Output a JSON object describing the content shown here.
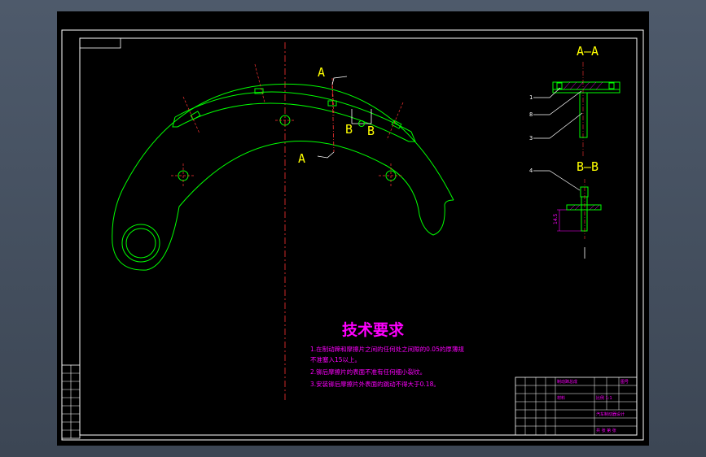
{
  "colors": {
    "background": "#4e5a6b",
    "sheet": "#000000",
    "outline": "#00ff00",
    "centerline": "#ff3333",
    "section_label": "#ffff00",
    "notes": "#ff00ff",
    "leader": "#ffffff"
  },
  "main_view": {
    "section_a_top": "A",
    "section_a_bottom": "A",
    "section_b_left": "B",
    "section_b_right": "B"
  },
  "section_views": {
    "aa_title": "A—A",
    "bb_title": "B—B",
    "callouts": [
      "1",
      "8",
      "3",
      "4"
    ],
    "dimension": "14.5"
  },
  "notes": {
    "title": "技术要求",
    "lines": [
      "1.在制动蹄和摩擦片之间的任何处之间隙的0.05的厚薄规",
      "不准塞入15以上。",
      "2.铆后摩擦片的表面不准有任何细小裂纹。",
      "3.安装铆后摩擦片外表面的跳动不得大于0.18。"
    ]
  },
  "title_block": {
    "texts": [
      "制动蹄总成",
      "比例 1:1",
      "汽车制动器设计",
      "材料",
      "图号",
      "共 张 第 张"
    ]
  }
}
